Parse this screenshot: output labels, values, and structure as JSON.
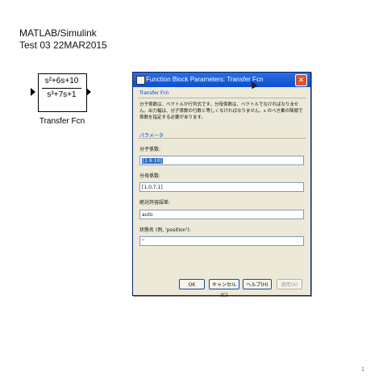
{
  "slide": {
    "title_line1": "MATLAB/Simulink",
    "title_line2": "Test 03 22MAR2015",
    "page_number": "1"
  },
  "block": {
    "numerator": "s²+6s+10",
    "denominator": "s³+7s+1",
    "name": "Transfer Fcn"
  },
  "dialog": {
    "title": "Function Block Parameters: Transfer Fcn",
    "section_label": "Transfer Fcn",
    "description": "分子係数は、ベクトルか行列式です。分母係数は、ベクトルでなければなりません。出力幅は、分子係数の行数と等しくなければなりません。s のべき乗の降順で係数を指定する必要があります。",
    "params_label": "パラメータ",
    "numerator_label": "分子係数:",
    "numerator_value": "[1 6 10]",
    "denominator_label": "分母係数:",
    "denominator_value": "[1,0,7,1]",
    "abstol_label": "絶対許容誤差:",
    "abstol_value": "auto",
    "statename_label": "状態名 (例, 'position'):",
    "statename_value": "''",
    "buttons": {
      "ok": "OK",
      "cancel": "キャンセル(C)",
      "help": "ヘルプ(H)",
      "apply": "適用(A)"
    }
  },
  "colors": {
    "titlebar": "#0a4fd0",
    "dialog_bg": "#ece9d8",
    "group_label": "#0046d5",
    "selection": "#316ac5"
  }
}
